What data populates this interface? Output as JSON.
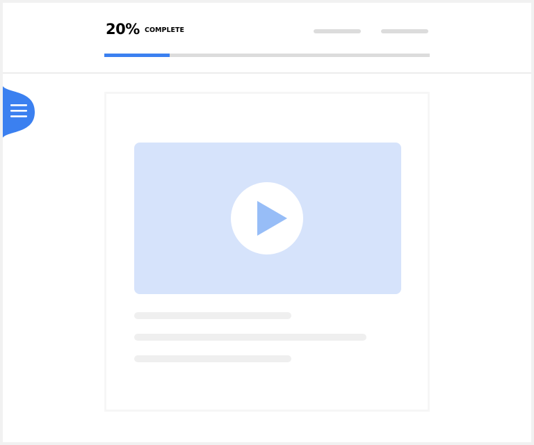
{
  "progress": {
    "percent_text": "20%",
    "status_label": "COMPLETE",
    "fraction": 0.2
  },
  "header": {
    "nav_placeholders": 2
  },
  "menu_button": {
    "icon": "hamburger-menu-icon"
  },
  "lesson": {
    "video_icon": "play-icon",
    "text_placeholder_lines": 3
  },
  "colors": {
    "accent": "#3b80f0",
    "progress_track": "#dcdcdc",
    "video_background": "#d6e3fb",
    "play_triangle": "#97bdf7",
    "placeholder": "#efefef"
  }
}
